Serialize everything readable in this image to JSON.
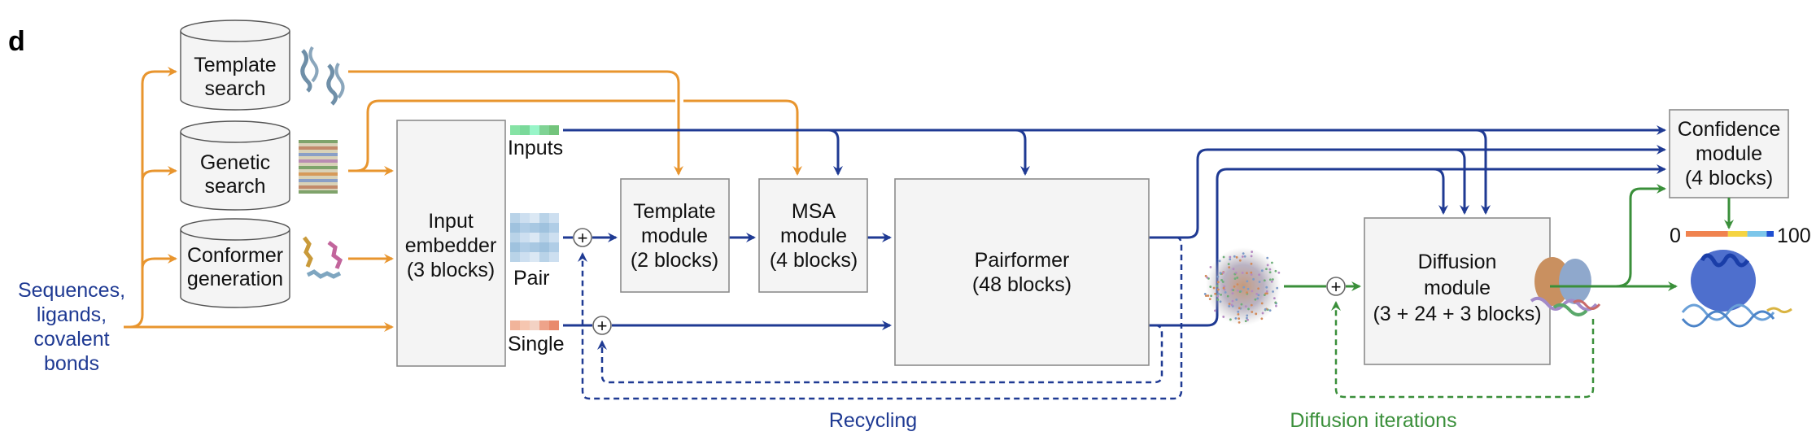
{
  "panel_label": "d",
  "inputs_text": [
    "Sequences,",
    "ligands,",
    "covalent",
    "bonds"
  ],
  "databases": [
    {
      "id": "template-search",
      "lines": [
        "Template",
        "search"
      ],
      "icon": "protein-structure-icon"
    },
    {
      "id": "genetic-search",
      "lines": [
        "Genetic",
        "search"
      ],
      "icon": "msa-alignment-icon"
    },
    {
      "id": "conformer-generation",
      "lines": [
        "Conformer",
        "generation"
      ],
      "icon": "ligand-conformer-icon"
    }
  ],
  "input_embedder": {
    "lines": [
      "Input",
      "embedder",
      "(3 blocks)"
    ]
  },
  "representations": {
    "inputs": "Inputs",
    "pair": "Pair",
    "single": "Single"
  },
  "modules": {
    "template": {
      "lines": [
        "Template",
        "module",
        "(2 blocks)"
      ]
    },
    "msa": {
      "lines": [
        "MSA",
        "module",
        "(4 blocks)"
      ]
    },
    "pairformer": {
      "lines": [
        "Pairformer",
        "(48 blocks)"
      ]
    },
    "diffusion": {
      "lines": [
        "Diffusion",
        "module",
        "(3 + 24 + 3 blocks)"
      ]
    },
    "confidence": {
      "lines": [
        "Confidence",
        "module",
        "(4 blocks)"
      ]
    }
  },
  "plus_symbol": "+",
  "confidence_scale": {
    "min": "0",
    "max": "100",
    "colors": [
      "#f0834f",
      "#f5d442",
      "#7cc6ea",
      "#1f4fd1"
    ]
  },
  "loops": {
    "recycling": "Recycling",
    "diffusion_iterations": "Diffusion iterations"
  },
  "colors": {
    "orange": "#e8952e",
    "blue": "#1f3a93",
    "green": "#3a8f3a"
  }
}
